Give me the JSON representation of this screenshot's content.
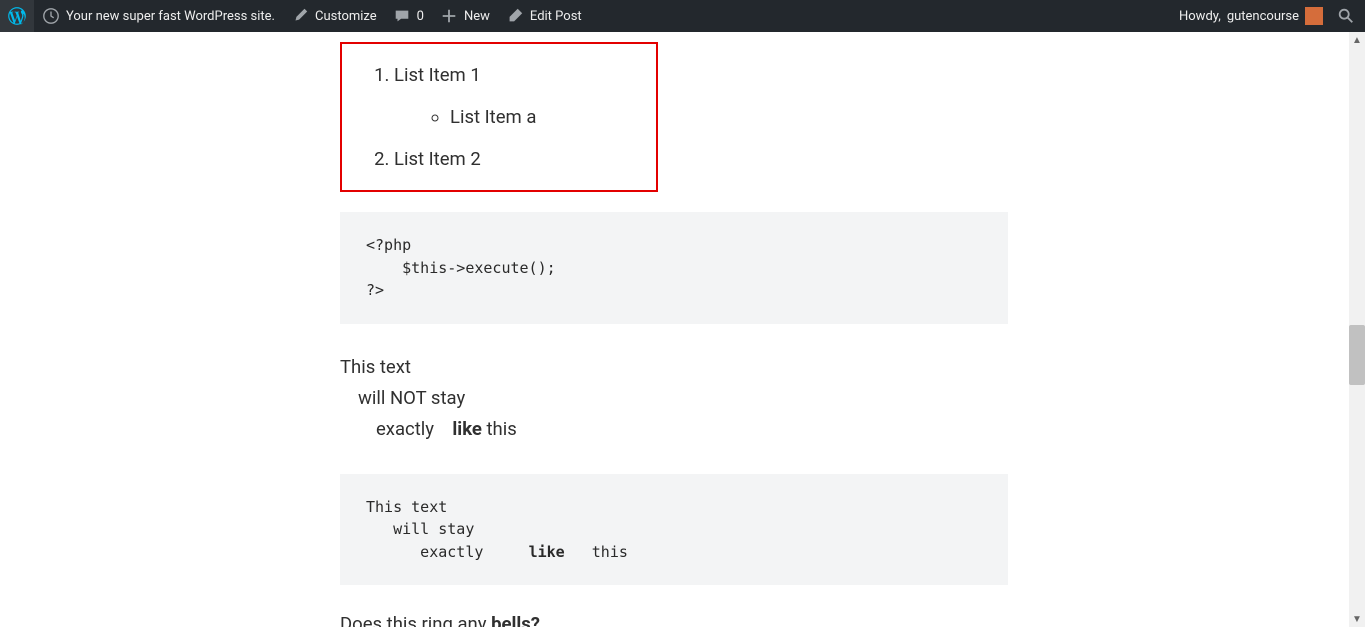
{
  "adminbar": {
    "site_name": "Your new super fast WordPress site.",
    "customize": "Customize",
    "comments_count": "0",
    "new": "New",
    "edit_post": "Edit Post",
    "howdy_prefix": "Howdy, ",
    "username": "gutencourse"
  },
  "redbox": {
    "item1": "List Item 1",
    "item_a": "List Item a",
    "item2": "List Item 2"
  },
  "code_block": "<?php\n    $this->execute();\n?>",
  "paragraph": {
    "line1": "This text",
    "line2": "will NOT stay",
    "line3a": "exactly",
    "line3b": "like",
    "line3c": " this"
  },
  "pre_block": "This text\n   will stay\n      exactly     like   this",
  "pre_block_parts": {
    "prefix": "This text\n   will stay\n      exactly     ",
    "bold": "like",
    "suffix": "   this"
  },
  "bells": {
    "prefix": "Does this ring any ",
    "bold": "bells?"
  }
}
